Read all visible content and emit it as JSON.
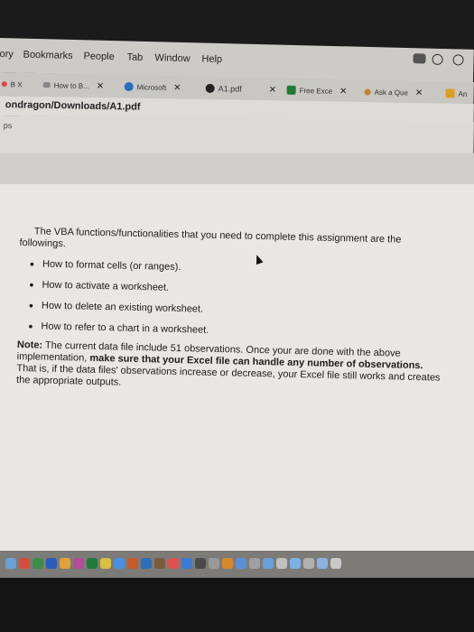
{
  "menubar": {
    "items": [
      "ory",
      "Bookmarks",
      "People",
      "Tab",
      "Window",
      "Help"
    ]
  },
  "tabs": [
    {
      "label": "B X",
      "color": "#d44"
    },
    {
      "label": "How to B...",
      "color": "#888"
    },
    {
      "label": "Microsoft",
      "color": "#2b6cc4"
    },
    {
      "label": "A1.pdf",
      "color": "#222"
    },
    {
      "label": "Free Exce",
      "color": "#1f7a3a"
    },
    {
      "label": "Ask a Que",
      "color": "#c0842b"
    },
    {
      "label": "An",
      "color": "#d9a020"
    }
  ],
  "address": {
    "url": "ondragon/Downloads/A1.pdf"
  },
  "bookmarks": {
    "text": "ps"
  },
  "document": {
    "intro": "The VBA functions/functionalities that you need to complete this assignment are the followings.",
    "bullets": [
      "How to format cells (or ranges).",
      "How to activate a worksheet.",
      "How to delete an existing worksheet.",
      "How to refer to a chart in a worksheet."
    ],
    "note_label": "Note:",
    "note_text_1": "The current data file include 51 observations. Once your are done with the above implementation,",
    "note_bold": "make sure that your Excel file can handle any number of observations.",
    "note_text_2": "That is, if the data files' observations increase or decrease, your Excel file still works and creates the appropriate outputs."
  }
}
